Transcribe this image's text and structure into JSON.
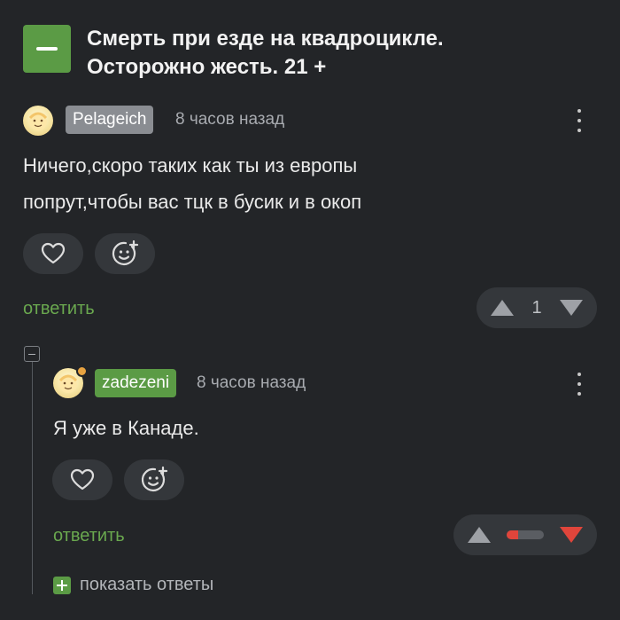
{
  "post": {
    "title_line1": "Смерть при езде на квадроцикле.",
    "title_line2": "Осторожно жесть. 21 +"
  },
  "comments": [
    {
      "username": "Pelageich",
      "username_color": "#8a8d92",
      "time": "8 часов назад",
      "text_line1": "Ничего,скоро таких как ты из европы",
      "text_line2": "попрут,чтобы вас тцк в бусик и в окоп",
      "reply_label": "ответить",
      "rating": "1"
    },
    {
      "username": "zadezeni",
      "username_color": "#5b9b45",
      "time": "8 часов назад",
      "text_line1": "Я уже в Канаде.",
      "reply_label": "ответить",
      "rating_fill_fraction": 0.3
    }
  ],
  "show_replies_label": "показать ответы",
  "colors": {
    "background": "#232528",
    "accent_green": "#5b9b45",
    "downvote_red": "#e0453b",
    "online_dot": "#e8a341"
  },
  "icons": [
    "minus-icon",
    "heart-icon",
    "emoji-add-icon",
    "upvote-arrow-icon",
    "downvote-arrow-icon",
    "kebab-menu-icon",
    "plus-icon"
  ]
}
